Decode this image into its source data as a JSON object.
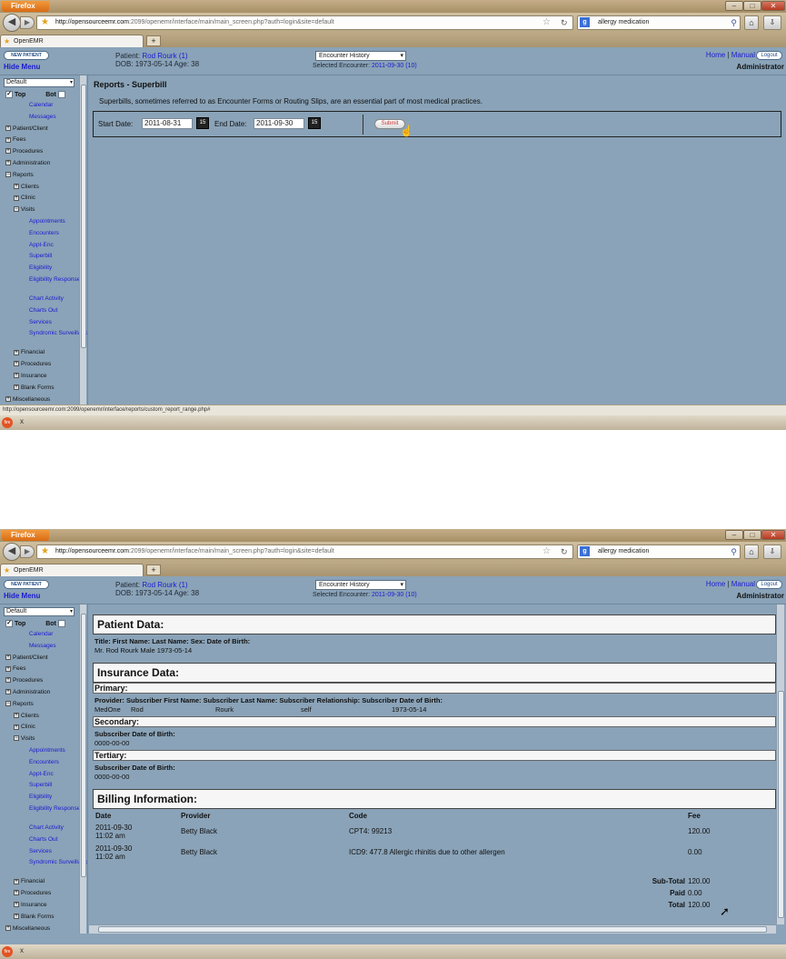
{
  "browser": {
    "app_button": "Firefox",
    "url_host": "http://opensourceemr.com",
    "url_path": ":2099/openemr/interface/main/main_screen.php?auth=login&site=default",
    "search_text": "allergy medication",
    "tab_title": "OpenEMR",
    "status_url": "http://opensourceemr.com:2099/openemr/interface/reports/custom_report_range.php#",
    "taskbar_label": "x"
  },
  "header": {
    "new_patient": "NEW PATIENT",
    "hide_menu": "Hide Menu",
    "patient_label": "Patient: ",
    "patient_name": "Rod Rourk (1)",
    "dob_line": "DOB: 1973-05-14 Age: 38",
    "encounter_select": "Encounter History",
    "selected_encounter_label": "Selected Encounter: ",
    "selected_encounter_value": "2011-09-30 (10)",
    "home": "Home",
    "sep": "|",
    "manual": "Manual",
    "logout": "Logout",
    "user": "Administrator"
  },
  "sidebar": {
    "select_value": "Default",
    "top_label": "Top",
    "bot_label": "Bot",
    "items": [
      {
        "label": "Calendar",
        "level": 2
      },
      {
        "label": "Messages",
        "level": 2
      },
      {
        "label": "Patient/Client",
        "level": 0
      },
      {
        "label": "Fees",
        "level": 0
      },
      {
        "label": "Procedures",
        "level": 0
      },
      {
        "label": "Administration",
        "level": 0
      },
      {
        "label": "Reports",
        "level": 0,
        "open": true
      },
      {
        "label": "Clients",
        "level": 1
      },
      {
        "label": "Clinic",
        "level": 1
      },
      {
        "label": "Visits",
        "level": 1,
        "open": true
      },
      {
        "label": "Appointments",
        "level": 2
      },
      {
        "label": "Encounters",
        "level": 2
      },
      {
        "label": "Appt-Enc",
        "level": 2
      },
      {
        "label": "Superbill",
        "level": 2
      },
      {
        "label": "Eligibility",
        "level": 2
      },
      {
        "label": "Eligibility Response",
        "level": 2
      },
      {
        "label": "Chart Activity",
        "level": 2
      },
      {
        "label": "Charts Out",
        "level": 2
      },
      {
        "label": "Services",
        "level": 2
      },
      {
        "label": "Syndromic Surveillance",
        "level": 2
      },
      {
        "label": "Financial",
        "level": 1
      },
      {
        "label": "Procedures",
        "level": 1
      },
      {
        "label": "Insurance",
        "level": 1
      },
      {
        "label": "Blank Forms",
        "level": 1
      },
      {
        "label": "Miscellaneous",
        "level": 0
      }
    ]
  },
  "report": {
    "title": "Reports - Superbill",
    "description": "Superbills, sometimes referred to as Encounter Forms or Routing Slips, are an essential part of most medical practices.",
    "start_label": "Start Date:",
    "start_value": "2011-08-31",
    "end_label": "End Date:",
    "end_value": "2011-09-30",
    "calendar_icon_text": "15",
    "submit": "Submit"
  },
  "superbill": {
    "patient_heading": "Patient Data:",
    "patient_fields": "Title: First Name: Last Name: Sex: Date of Birth:",
    "patient_values": "Mr.    Rod        Rourk       Male 1973-05-14",
    "insurance_heading": "Insurance Data:",
    "primary_label": "Primary:",
    "primary_fields": "Provider: Subscriber First Name: Subscriber Last Name: Subscriber Relationship: Subscriber Date of Birth:",
    "primary_values": {
      "provider": "MedOne",
      "first": "Rod",
      "last": "Rourk",
      "relationship": "self",
      "dob": "1973-05-14"
    },
    "secondary_label": "Secondary:",
    "secondary_field": "Subscriber Date of Birth:",
    "secondary_value": "0000-00-00",
    "tertiary_label": "Tertiary:",
    "tertiary_field": "Subscriber Date of Birth:",
    "tertiary_value": "0000-00-00",
    "billing_heading": "Billing Information:",
    "columns": [
      "Date",
      "Provider",
      "Code",
      "Fee"
    ],
    "rows": [
      {
        "date": "2011-09-30",
        "time": "11:02 am",
        "provider": "Betty Black",
        "code": "CPT4: 99213",
        "fee": "120.00"
      },
      {
        "date": "2011-09-30",
        "time": "11:02 am",
        "provider": "Betty Black",
        "code": "ICD9: 477.8   Allergic rhinitis due to other allergen",
        "fee": "0.00"
      }
    ],
    "subtotal_label": "Sub-Total",
    "subtotal_value": "120.00",
    "paid_label": "Paid",
    "paid_value": "0.00",
    "total_label": "Total",
    "total_value": "120.00"
  },
  "colors": {
    "app_bg": "#8aa3b8",
    "link": "#1b1bd0",
    "firefox_orange": "#e8822a"
  }
}
